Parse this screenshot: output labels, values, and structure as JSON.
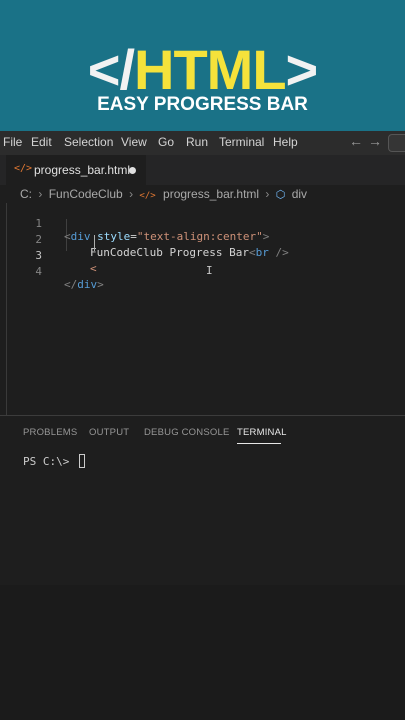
{
  "banner": {
    "open_bracket": "</",
    "highlight": "HTML",
    "close_bracket": ">",
    "subtitle": "EASY PROGRESS BAR"
  },
  "menubar": {
    "items": [
      "File",
      "Edit",
      "Selection",
      "View",
      "Go",
      "Run",
      "Terminal",
      "Help"
    ],
    "back_arrow": "←",
    "forward_arrow": "→"
  },
  "tab": {
    "icon": "</>",
    "label": "progress_bar.html",
    "modified": true
  },
  "breadcrumb": {
    "drive": "C:",
    "sep": "›",
    "folder": "FunCodeClub",
    "file_icon": "</>",
    "file": "progress_bar.html",
    "element_icon": "⬡",
    "element": "div"
  },
  "editor": {
    "line_numbers": [
      "1",
      "2",
      "3",
      "4"
    ],
    "line1": {
      "open": "<",
      "tag": "div",
      "attr": "style",
      "eq": "=",
      "value": "\"text-align:center\"",
      "close": ">"
    },
    "line2": {
      "text": "FunCodeClub Progress Bar",
      "open": "<",
      "tag": "br",
      "close": " />"
    },
    "line3": {
      "text": "<"
    },
    "line4": {
      "open": "</",
      "tag": "div",
      "close": ">"
    },
    "mouse_cursor": "I"
  },
  "panel": {
    "tabs": [
      "PROBLEMS",
      "OUTPUT",
      "DEBUG CONSOLE",
      "TERMINAL"
    ],
    "active_tab": "TERMINAL",
    "terminal_prompt": "PS C:\\> "
  },
  "colors": {
    "banner_bg": "#1a7287",
    "banner_highlight": "#f5e23b",
    "editor_bg": "#1e1e1e",
    "tag": "#569cd6",
    "attr": "#9cdcfe",
    "string": "#ce9178"
  }
}
